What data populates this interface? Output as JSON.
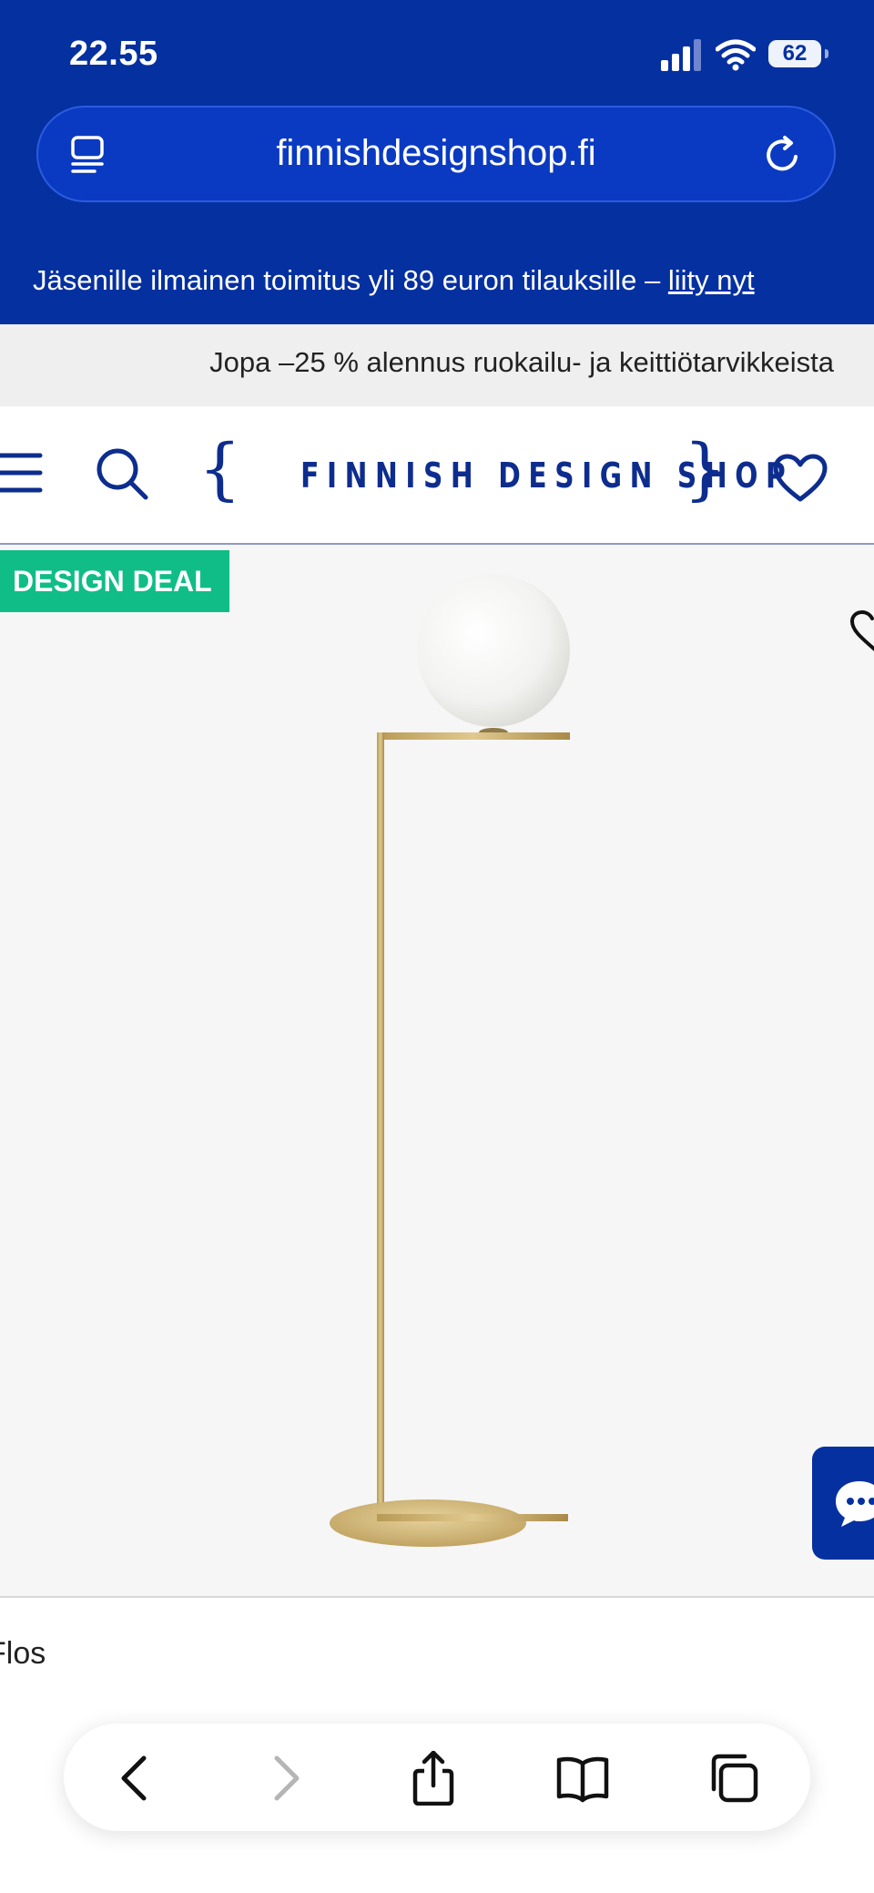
{
  "status_bar": {
    "time": "22.55",
    "battery": "62",
    "icons": [
      "signal-icon",
      "wifi-icon",
      "battery-icon"
    ]
  },
  "browser": {
    "url": "finnishdesignshop.fi",
    "left_icon": "page-menu-icon",
    "right_icon": "reload-icon"
  },
  "promo_bar": {
    "text": "Jäsenille ilmainen toimitus yli 89 euron tilauksille –",
    "link": "liity nyt"
  },
  "promo_secondary": {
    "text": "Jopa –25 % alennus ruokailu- ja keittiötarvikkeista"
  },
  "header": {
    "logo": "FINNISH DESIGN SHOP",
    "icons": [
      "menu-icon",
      "search-icon",
      "heart-icon"
    ]
  },
  "product": {
    "badge": "DESIGN DEAL",
    "brand": "Flos"
  },
  "bottom_toolbar": {
    "buttons": [
      "back-icon",
      "forward-icon",
      "share-icon",
      "bookmarks-icon",
      "tabs-icon"
    ]
  },
  "colors": {
    "brand_blue": "#0530a0",
    "logo_blue": "#0d2d8e",
    "deal_green": "#10bd86",
    "product_bg": "#f6f6f6"
  }
}
